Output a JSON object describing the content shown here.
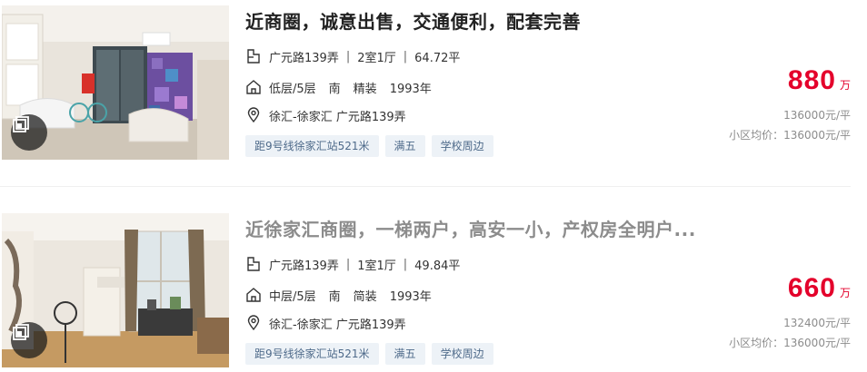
{
  "listings": [
    {
      "title": "近商圈，诚意出售，交通便利，配套完善",
      "road": "广元路139弄",
      "layout": "2室1厅",
      "area": "64.72平",
      "floor": "低层/5层",
      "orientation": "南",
      "decoration": "精装",
      "year": "1993年",
      "location": "徐汇-徐家汇 广元路139弄",
      "tags": [
        "距9号线徐家汇站521米",
        "满五",
        "学校周边"
      ],
      "total_price": "880",
      "total_unit": "万",
      "unit_price": "136000元/平",
      "community_avg": "小区均价：136000元/平"
    },
    {
      "title": "近徐家汇商圈，一梯两户，高安一小，产权房全明户...",
      "road": "广元路139弄",
      "layout": "1室1厅",
      "area": "49.84平",
      "floor": "中层/5层",
      "orientation": "南",
      "decoration": "简装",
      "year": "1993年",
      "location": "徐汇-徐家汇 广元路139弄",
      "tags": [
        "距9号线徐家汇站521米",
        "满五",
        "学校周边"
      ],
      "total_price": "660",
      "total_unit": "万",
      "unit_price": "132400元/平",
      "community_avg": "小区均价：136000元/平"
    }
  ],
  "separator": "|",
  "colors": {
    "price_red": "#e4002b",
    "tag_bg": "#edf2f7",
    "tag_text": "#4e6a8a",
    "visited_title": "#8c8c8c"
  },
  "icons": {
    "layout": "floorplan-icon",
    "floor": "house-icon",
    "location": "map-pin-icon",
    "vr": "vr-tour-icon"
  }
}
